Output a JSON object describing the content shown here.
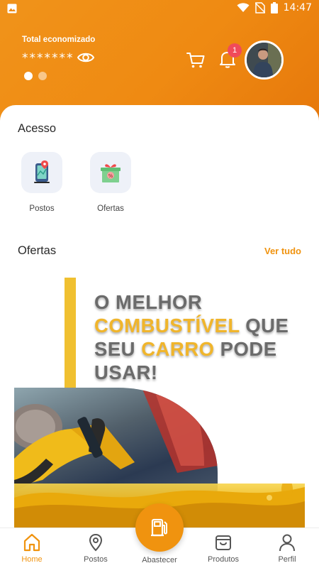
{
  "status_bar": {
    "time": "14:47"
  },
  "header": {
    "saved_label": "Total economizado",
    "saved_value": "*******",
    "notification_count": "1"
  },
  "access": {
    "title": "Acesso",
    "items": [
      {
        "label": "Postos",
        "icon": "map-phone-icon"
      },
      {
        "label": "Ofertas",
        "icon": "gift-box-icon"
      }
    ]
  },
  "offers": {
    "title": "Ofertas",
    "see_all": "Ver tudo",
    "banner": {
      "line1": "O MELHOR",
      "line2_highlight": "COMBUSTÍVEL",
      "line2_rest": " QUE",
      "line3_start": "SEU ",
      "line3_highlight": "CARRO",
      "line3_rest": " PODE",
      "line4": "USAR!"
    }
  },
  "bottom_nav": {
    "home": "Home",
    "postos": "Postos",
    "abastecer": "Abastecer",
    "produtos": "Produtos",
    "perfil": "Perfil"
  },
  "colors": {
    "accent": "#f0930f",
    "badge": "#f04b5a",
    "banner_highlight": "#f0b52c"
  }
}
